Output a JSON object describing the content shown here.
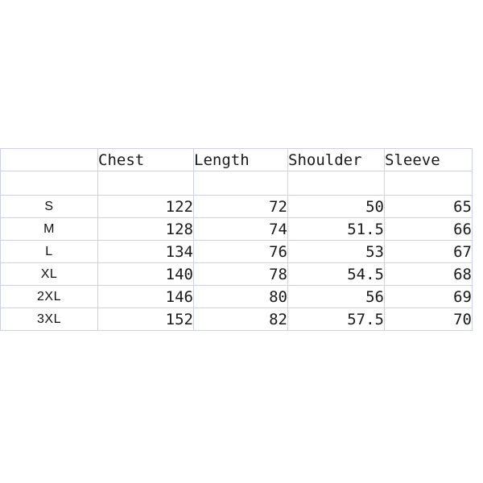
{
  "chart_data": {
    "type": "table",
    "title": "",
    "columns": [
      "",
      "Chest",
      "Length",
      "Shoulder",
      "Sleeve"
    ],
    "row_labels": [
      "S",
      "M",
      "L",
      "XL",
      "2XL",
      "3XL"
    ],
    "series": [
      {
        "name": "Chest",
        "values": [
          122,
          128,
          134,
          140,
          146,
          152
        ]
      },
      {
        "name": "Length",
        "values": [
          72,
          74,
          76,
          78,
          80,
          82
        ]
      },
      {
        "name": "Shoulder",
        "values": [
          50,
          51.5,
          53,
          54.5,
          56,
          57.5
        ]
      },
      {
        "name": "Sleeve",
        "values": [
          65,
          66,
          67,
          68,
          69,
          70
        ]
      }
    ],
    "rows": [
      {
        "size": "S",
        "chest": "122",
        "length": "72",
        "shoulder": "50",
        "sleeve": "65"
      },
      {
        "size": "M",
        "chest": "128",
        "length": "74",
        "shoulder": "51.5",
        "sleeve": "66"
      },
      {
        "size": "L",
        "chest": "134",
        "length": "76",
        "shoulder": "53",
        "sleeve": "67"
      },
      {
        "size": "XL",
        "chest": "140",
        "length": "78",
        "shoulder": "54.5",
        "sleeve": "68"
      },
      {
        "size": "2XL",
        "chest": "146",
        "length": "80",
        "shoulder": "56",
        "sleeve": "69"
      },
      {
        "size": "3XL",
        "chest": "152",
        "length": "82",
        "shoulder": "57.5",
        "sleeve": "70"
      }
    ],
    "has_spacer_row": true,
    "grid": true,
    "legend": "none"
  },
  "table": {
    "headers": {
      "size": "",
      "chest": "Chest",
      "length": "Length",
      "shoulder": "Shoulder",
      "sleeve": "Sleeve"
    },
    "rows": [
      {
        "size": "S",
        "chest": "122",
        "length": "72",
        "shoulder": "50",
        "sleeve": "65"
      },
      {
        "size": "M",
        "chest": "128",
        "length": "74",
        "shoulder": "51.5",
        "sleeve": "66"
      },
      {
        "size": "L",
        "chest": "134",
        "length": "76",
        "shoulder": "53",
        "sleeve": "67"
      },
      {
        "size": "XL",
        "chest": "140",
        "length": "78",
        "shoulder": "54.5",
        "sleeve": "68"
      },
      {
        "size": "2XL",
        "chest": "146",
        "length": "80",
        "shoulder": "56",
        "sleeve": "69"
      },
      {
        "size": "3XL",
        "chest": "152",
        "length": "82",
        "shoulder": "57.5",
        "sleeve": "70"
      }
    ]
  },
  "colors": {
    "gridline": "#ccd0e2",
    "text": "#1a1a1a",
    "background": "#ffffff"
  }
}
